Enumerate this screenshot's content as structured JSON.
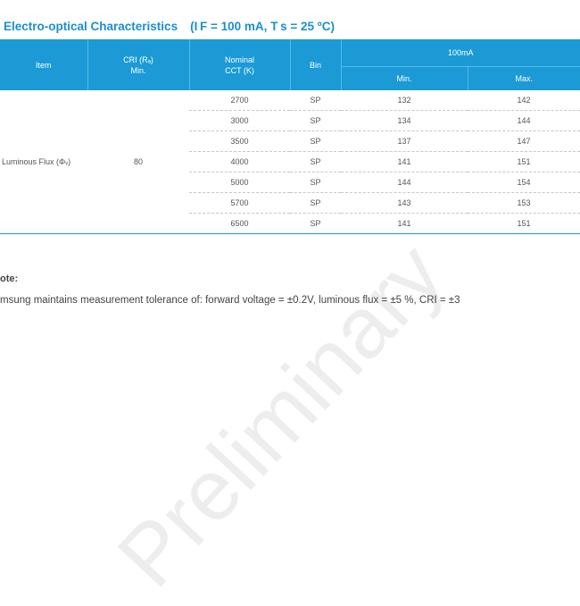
{
  "section": {
    "title": "Electro-optical Characteristics",
    "condition": "(I F = 100 mA, T s = 25 ºC)"
  },
  "table": {
    "headers": {
      "item": "Item",
      "cri": "CRI (Rₐ)",
      "cri_sub": "Min.",
      "cct": "Nominal",
      "cct_sub": "CCT (K)",
      "bin": "Bin",
      "current": "100mA",
      "min": "Min.",
      "max": "Max."
    },
    "item_label": "Luminous Flux (Φᵥ)",
    "cri_value": "80",
    "rows": [
      {
        "cct": "2700",
        "bin": "SP",
        "min": "132",
        "max": "142"
      },
      {
        "cct": "3000",
        "bin": "SP",
        "min": "134",
        "max": "144"
      },
      {
        "cct": "3500",
        "bin": "SP",
        "min": "137",
        "max": "147"
      },
      {
        "cct": "4000",
        "bin": "SP",
        "min": "141",
        "max": "151"
      },
      {
        "cct": "5000",
        "bin": "SP",
        "min": "144",
        "max": "154"
      },
      {
        "cct": "5700",
        "bin": "SP",
        "min": "143",
        "max": "153"
      },
      {
        "cct": "6500",
        "bin": "SP",
        "min": "141",
        "max": "151"
      }
    ]
  },
  "note": {
    "heading": "ote:",
    "text": "msung maintains measurement tolerance of: forward voltage =  ±0.2V, luminous flux = ±5 %, CRI =  ±3"
  },
  "watermark": "Preliminary"
}
